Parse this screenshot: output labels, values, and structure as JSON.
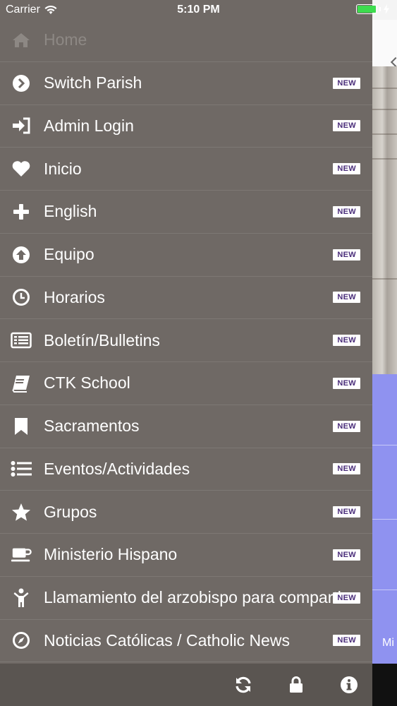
{
  "status_bar": {
    "carrier": "Carrier",
    "time": "5:10 PM"
  },
  "menu": {
    "items": [
      {
        "label": "Home",
        "icon": "home-icon",
        "badge": ""
      },
      {
        "label": "Switch Parish",
        "icon": "chevron-circle-icon",
        "badge": "NEW"
      },
      {
        "label": "Admin Login",
        "icon": "sign-in-icon",
        "badge": "NEW"
      },
      {
        "label": "Inicio",
        "icon": "heart-icon",
        "badge": "NEW"
      },
      {
        "label": "English",
        "icon": "plus-icon",
        "badge": "NEW"
      },
      {
        "label": "Equipo",
        "icon": "arrow-up-circle-icon",
        "badge": "NEW"
      },
      {
        "label": "Horarios",
        "icon": "clock-icon",
        "badge": "NEW"
      },
      {
        "label": "Boletín/Bulletins",
        "icon": "list-alt-icon",
        "badge": "NEW"
      },
      {
        "label": "CTK School",
        "icon": "book-icon",
        "badge": "NEW"
      },
      {
        "label": "Sacramentos",
        "icon": "bookmark-icon",
        "badge": "NEW"
      },
      {
        "label": "Eventos/Actividades",
        "icon": "list-icon",
        "badge": "NEW"
      },
      {
        "label": "Grupos",
        "icon": "star-icon",
        "badge": "NEW"
      },
      {
        "label": "Ministerio Hispano",
        "icon": "coffee-icon",
        "badge": "NEW"
      },
      {
        "label": "Llamamiento del arzobispo para compartir",
        "icon": "child-icon",
        "badge": "NEW"
      },
      {
        "label": "Noticias Católicas / Catholic News",
        "icon": "compass-icon",
        "badge": "NEW"
      }
    ]
  },
  "toolbar": {
    "refresh": "refresh-icon",
    "lock": "lock-icon",
    "info": "info-icon"
  },
  "peek": {
    "text": "Mi"
  },
  "colors": {
    "drawer": "#6f6965",
    "toolbar": "#5a5551",
    "badge_text": "#4a2d7a",
    "peek_panel": "#8f92f0"
  }
}
